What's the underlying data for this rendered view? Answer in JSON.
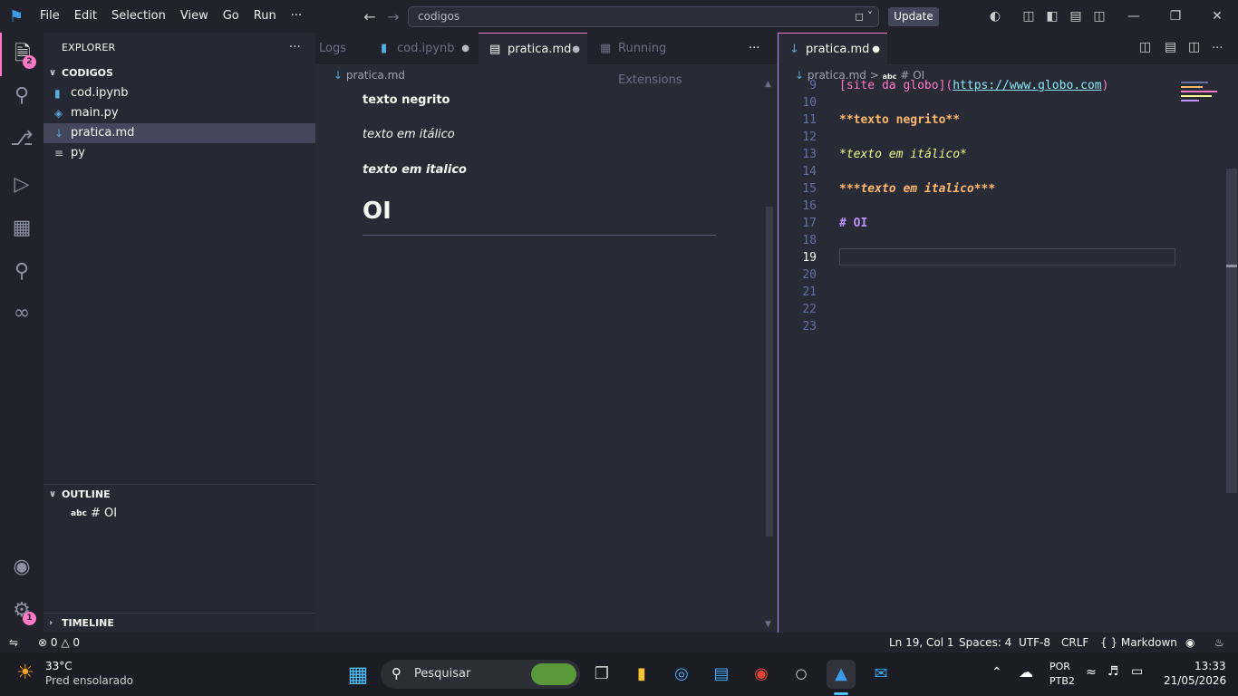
{
  "titlebar": {
    "menu": [
      "File",
      "Edit",
      "Selection",
      "View",
      "Go",
      "Run",
      "···"
    ],
    "search": "codigos",
    "update": "Update"
  },
  "activity": {
    "explorer_badge": "2",
    "settings_badge": "1"
  },
  "sidebar": {
    "header": "EXPLORER",
    "dots": "···",
    "folder": "CODIGOS",
    "files": [
      {
        "name": "cod.ipynb",
        "icon": "notebook-icon"
      },
      {
        "name": "main.py",
        "icon": "python-icon"
      },
      {
        "name": "pratica.md",
        "icon": "markdown-icon"
      },
      {
        "name": "py",
        "icon": "text-file-icon"
      }
    ],
    "outline_title": "OUTLINE",
    "outline_item": "# OI",
    "outline_abc": "abc",
    "timeline_title": "TIMELINE"
  },
  "group1": {
    "tabs": [
      "Logs",
      "cod.ipynb",
      "pratica.md",
      "Running Extensions"
    ],
    "tabs_more": "···",
    "breadcrumb": "pratica.md",
    "preview": {
      "bold": "texto negrito",
      "italic": "texto em itálico",
      "bold_italic": "texto em italico",
      "h1": "OI"
    }
  },
  "group2": {
    "tab": "pratica.md",
    "breadcrumb_file": "pratica.md",
    "breadcrumb_sep": ">",
    "breadcrumb_abc": "abc",
    "breadcrumb_symbol": "# OI",
    "line_numbers": [
      "9",
      "10",
      "11",
      "12",
      "13",
      "14",
      "15",
      "16",
      "17",
      "18",
      "19",
      "20",
      "21",
      "22",
      "23"
    ],
    "current_line": "19",
    "code": {
      "l9_text": "[site da globo]",
      "l9_open": "(",
      "l9_url": "https://www.globo.com",
      "l9_close": ")",
      "l11": "**texto negrito**",
      "l13": "*texto em itálico*",
      "l15": "***texto em italico***",
      "l17": "# OI"
    }
  },
  "statusbar": {
    "errors": "0",
    "warnings": "0",
    "position": "Ln 19, Col 1",
    "spaces": "Spaces: 4",
    "encoding": "UTF-8",
    "eol": "CRLF",
    "language_braces": "{ }",
    "language": "Markdown"
  },
  "taskbar": {
    "temp": "33°C",
    "weather": "Pred ensolarado",
    "search": "Pesquisar",
    "lang1": "POR",
    "lang2": "PTB2",
    "time": "13:33",
    "date": "21/05/2026"
  },
  "colors": {
    "accent": "#ff79c6",
    "background": "#282a36",
    "purple": "#bd93f9"
  }
}
